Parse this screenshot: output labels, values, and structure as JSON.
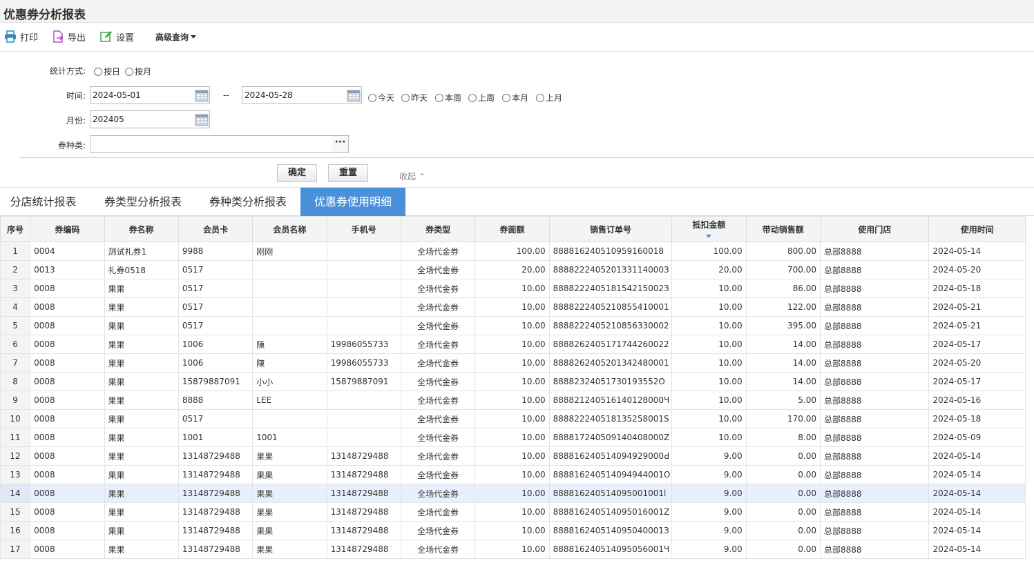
{
  "window": {
    "title": "优惠券分析报表"
  },
  "toolbar": {
    "print_label": "打印",
    "export_label": "导出",
    "settings_label": "设置",
    "advanced_label": "高级查询"
  },
  "filters": {
    "stat_mode_label": "统计方式:",
    "stat_mode_options": [
      "按日",
      "按月"
    ],
    "time_label": "时间:",
    "date_from": "2024-05-01",
    "date_sep": "--",
    "date_to": "2024-05-28",
    "quick_ranges": [
      "今天",
      "昨天",
      "本周",
      "上周",
      "本月",
      "上月"
    ],
    "month_label": "月份:",
    "month_value": "202405",
    "coupon_kind_label": "券种类:",
    "coupon_kind_value": "",
    "more_button": "···",
    "confirm_label": "确定",
    "reset_label": "重置",
    "collapse_label": "收起 ⌃"
  },
  "tabs": [
    {
      "label": "分店统计报表",
      "active": false
    },
    {
      "label": "券类型分析报表",
      "active": false
    },
    {
      "label": "券种类分析报表",
      "active": false
    },
    {
      "label": "优惠券使用明细",
      "active": true
    }
  ],
  "colors": {
    "accent": "#4a90d9",
    "highlight_row": "#e8f1fb"
  },
  "table": {
    "columns": [
      "序号",
      "券编码",
      "券名称",
      "会员卡",
      "会员名称",
      "手机号",
      "券类型",
      "券面额",
      "销售订单号",
      "抵扣金额",
      "带动销售额",
      "使用门店",
      "使用时间"
    ],
    "sorted_column": "抵扣金额",
    "highlighted_row": 14,
    "rows": [
      [
        "1",
        "0004",
        "测试礼券1",
        "9988",
        "刚刚",
        "",
        "全场代金券",
        "100.00",
        "888816240510959160018",
        "100.00",
        "800.00",
        "总部8888",
        "2024-05-14"
      ],
      [
        "2",
        "0013",
        "礼券0518",
        "0517",
        "",
        "",
        "全场代金券",
        "20.00",
        "888822240520133114000З",
        "20.00",
        "700.00",
        "总部8888",
        "2024-05-20"
      ],
      [
        "3",
        "0008",
        "果果",
        "0517",
        "",
        "",
        "全场代金券",
        "10.00",
        "888822240518154215002З",
        "10.00",
        "86.00",
        "总部8888",
        "2024-05-18"
      ],
      [
        "4",
        "0008",
        "果果",
        "0517",
        "",
        "",
        "全场代金券",
        "10.00",
        "8888222405210855410001",
        "10.00",
        "122.00",
        "总部8888",
        "2024-05-21"
      ],
      [
        "5",
        "0008",
        "果果",
        "0517",
        "",
        "",
        "全场代金券",
        "10.00",
        "8888222405210856330002",
        "10.00",
        "395.00",
        "总部8888",
        "2024-05-21"
      ],
      [
        "6",
        "0008",
        "果果",
        "1006",
        "陳",
        "19986055733",
        "全场代金券",
        "10.00",
        "8888262405171744260022",
        "10.00",
        "14.00",
        "总部8888",
        "2024-05-17"
      ],
      [
        "7",
        "0008",
        "果果",
        "1006",
        "陳",
        "19986055733",
        "全场代金券",
        "10.00",
        "8888262405201342480001",
        "10.00",
        "14.00",
        "总部8888",
        "2024-05-20"
      ],
      [
        "8",
        "0008",
        "果果",
        "15879887091",
        "小小",
        "15879887091",
        "全场代金券",
        "10.00",
        "88882324051730193552O",
        "10.00",
        "14.00",
        "总部8888",
        "2024-05-17"
      ],
      [
        "9",
        "0008",
        "果果",
        "8888",
        "LEE",
        "",
        "全场代金券",
        "10.00",
        "888821240516140128000Ч",
        "10.00",
        "5.00",
        "总部8888",
        "2024-05-16"
      ],
      [
        "10",
        "0008",
        "果果",
        "0517",
        "",
        "",
        "全场代金券",
        "10.00",
        "888822240518135258001S",
        "10.00",
        "170.00",
        "总部8888",
        "2024-05-18"
      ],
      [
        "11",
        "0008",
        "果果",
        "1001",
        "1001",
        "",
        "全场代金券",
        "10.00",
        "888817240509140408000Z",
        "10.00",
        "8.00",
        "总部8888",
        "2024-05-09"
      ],
      [
        "12",
        "0008",
        "果果",
        "13148729488",
        "果果",
        "13148729488",
        "全场代金券",
        "10.00",
        "888816240514094929000Ԁ",
        "9.00",
        "0.00",
        "总部8888",
        "2024-05-14"
      ],
      [
        "13",
        "0008",
        "果果",
        "13148729488",
        "果果",
        "13148729488",
        "全场代金券",
        "10.00",
        "888816240514094944001O",
        "9.00",
        "0.00",
        "总部8888",
        "2024-05-14"
      ],
      [
        "14",
        "0008",
        "果果",
        "13148729488",
        "果果",
        "13148729488",
        "全场代金券",
        "10.00",
        "888816240514095001001l",
        "9.00",
        "0.00",
        "总部8888",
        "2024-05-14"
      ],
      [
        "15",
        "0008",
        "果果",
        "13148729488",
        "果果",
        "13148729488",
        "全场代金券",
        "10.00",
        "888816240514095016001Z",
        "9.00",
        "0.00",
        "总部8888",
        "2024-05-14"
      ],
      [
        "16",
        "0008",
        "果果",
        "13148729488",
        "果果",
        "13148729488",
        "全场代金券",
        "10.00",
        "888816240514095040001З",
        "9.00",
        "0.00",
        "总部8888",
        "2024-05-14"
      ],
      [
        "17",
        "0008",
        "果果",
        "13148729488",
        "果果",
        "13148729488",
        "全场代金券",
        "10.00",
        "888816240514095056001Ч",
        "9.00",
        "0.00",
        "总部8888",
        "2024-05-14"
      ]
    ]
  }
}
